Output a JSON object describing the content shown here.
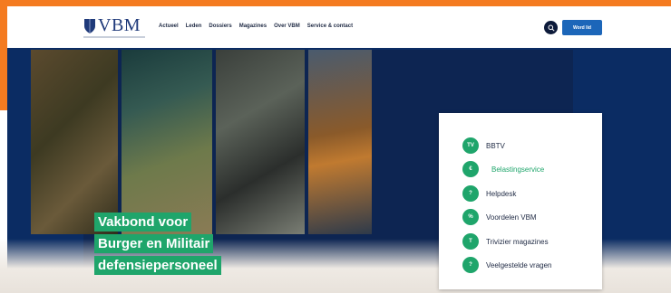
{
  "header": {
    "logo_text": "VBM",
    "nav": [
      "Actueel",
      "Leden",
      "Dossiers",
      "Magazines",
      "Over VBM",
      "Service & contact"
    ],
    "cta_label": "Word lid"
  },
  "hero": {
    "title_lines": [
      "Vakbond voor",
      "Burger en Militair",
      "defensiepersoneel"
    ]
  },
  "menu": {
    "items": [
      {
        "label": "BBTV",
        "icon": "tv-icon",
        "glyph": "TV"
      },
      {
        "label": "Belastingservice",
        "icon": "calculator-icon",
        "glyph": "€"
      },
      {
        "label": "Helpdesk",
        "icon": "question-icon",
        "glyph": "?"
      },
      {
        "label": "Voordelen VBM",
        "icon": "tag-icon",
        "glyph": "%"
      },
      {
        "label": "Trivizier magazines",
        "icon": "magazine-icon",
        "glyph": "T"
      },
      {
        "label": "Veelgestelde vragen",
        "icon": "chat-icon",
        "glyph": "?"
      }
    ],
    "active_index": 1
  },
  "colors": {
    "orange": "#f47b20",
    "navy": "#0b2c63",
    "green": "#1fa56b",
    "blue_cta": "#1c66b9"
  }
}
